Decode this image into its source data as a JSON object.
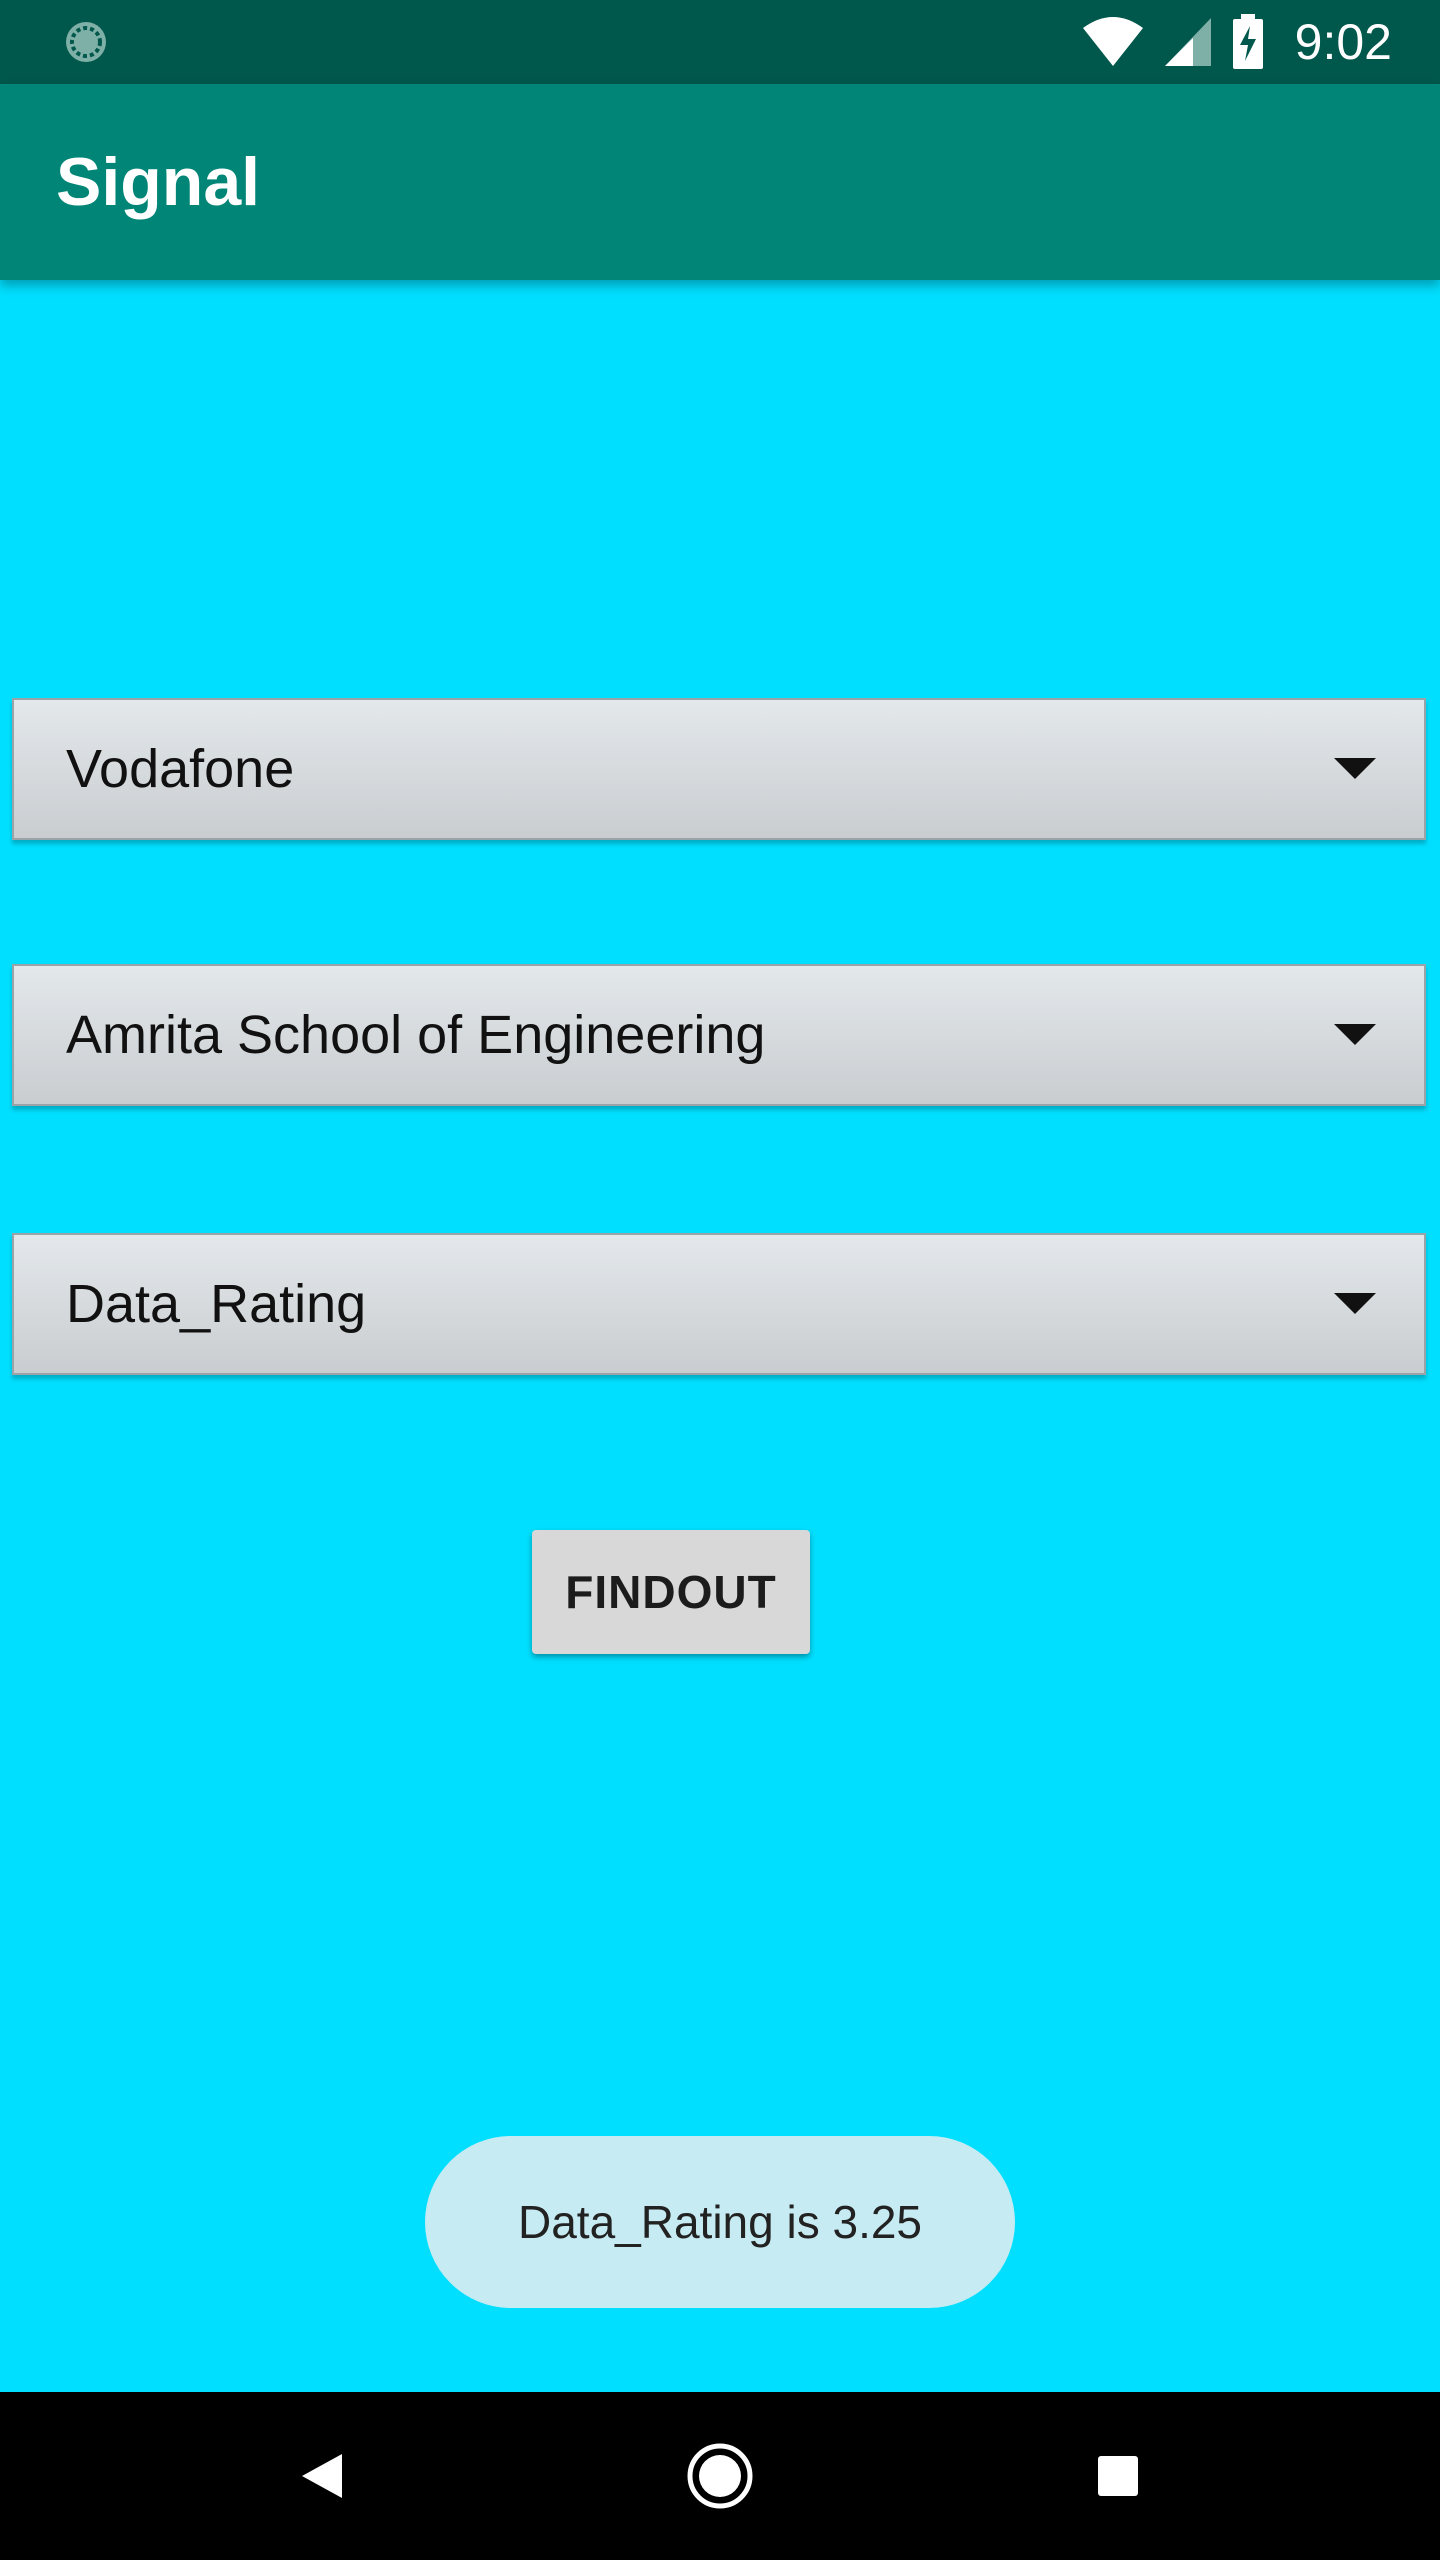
{
  "status_bar": {
    "time": "9:02",
    "left_icon": "sync-icon",
    "icons": [
      "wifi-icon",
      "cellular-signal-icon",
      "battery-charging-icon"
    ]
  },
  "app_bar": {
    "title": "Signal",
    "color": "#008577"
  },
  "spinners": [
    {
      "selected": "Vodafone"
    },
    {
      "selected": "Amrita School of Engineering"
    },
    {
      "selected": "Data_Rating"
    }
  ],
  "button": {
    "label": "FINDOUT"
  },
  "toast": {
    "message": "Data_Rating is 3.25"
  },
  "nav_bar": {
    "icons": [
      "back-icon",
      "home-icon",
      "recents-icon"
    ]
  },
  "colors": {
    "background": "#00dfff",
    "status_bar": "#00574b",
    "toast": "#c7ebf3"
  }
}
